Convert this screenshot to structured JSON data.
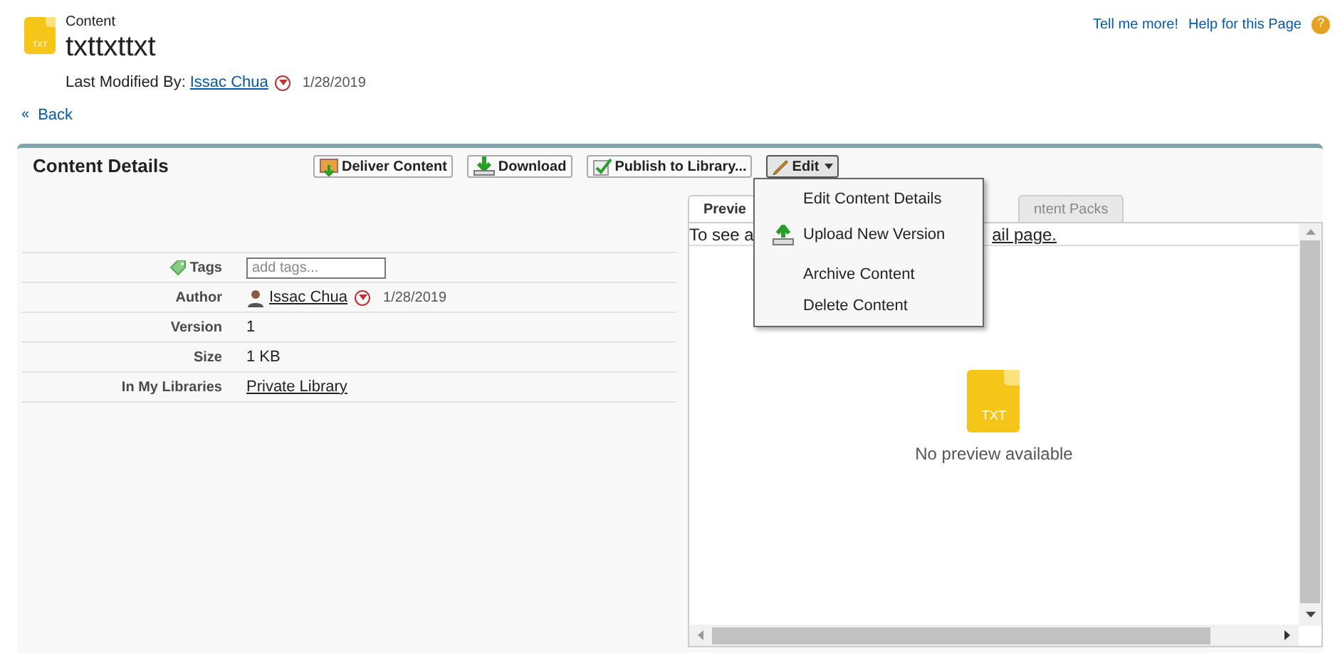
{
  "header": {
    "file_type": "TXT",
    "section": "Content",
    "title": "txttxttxt",
    "modified_label": "Last Modified By:",
    "modified_by": "Issac Chua",
    "modified_date": "1/28/2019"
  },
  "help_links": [
    "Tell me more!",
    "Help for this Page"
  ],
  "help_icon": "?",
  "back": {
    "mark": "«",
    "label": "Back"
  },
  "panel": {
    "title": "Content Details",
    "buttons": [
      {
        "kind": "deliver",
        "label": "Deliver Content"
      },
      {
        "kind": "download",
        "label": "Download"
      },
      {
        "kind": "publish",
        "label": "Publish to Library..."
      },
      {
        "kind": "edit",
        "label": "Edit",
        "expanded": true
      }
    ],
    "menu": [
      {
        "label": "Edit Content Details",
        "kind": "plain"
      },
      {
        "label": "Upload New Version",
        "kind": "upload"
      },
      {
        "label": "Archive Content",
        "kind": "plain"
      },
      {
        "label": "Delete Content",
        "kind": "plain"
      }
    ],
    "fields": [
      {
        "kind": "tags",
        "label": "Tags",
        "placeholder": "add tags..."
      },
      {
        "kind": "user",
        "label": "Author",
        "value": "Issac Chua",
        "date": "1/28/2019"
      },
      {
        "kind": "text",
        "label": "Version",
        "value": "1"
      },
      {
        "kind": "text",
        "label": "Size",
        "value": "1 KB"
      },
      {
        "kind": "link",
        "label": "In My Libraries",
        "value": "Private Library"
      }
    ],
    "tabs": [
      {
        "label": "Previe",
        "selected": true
      },
      {
        "label": "ntent Packs",
        "selected": false
      }
    ],
    "preview": {
      "message_start": "To see a",
      "message_end": "ail page.",
      "file_type": "TXT",
      "empty_text": "No preview available"
    }
  }
}
